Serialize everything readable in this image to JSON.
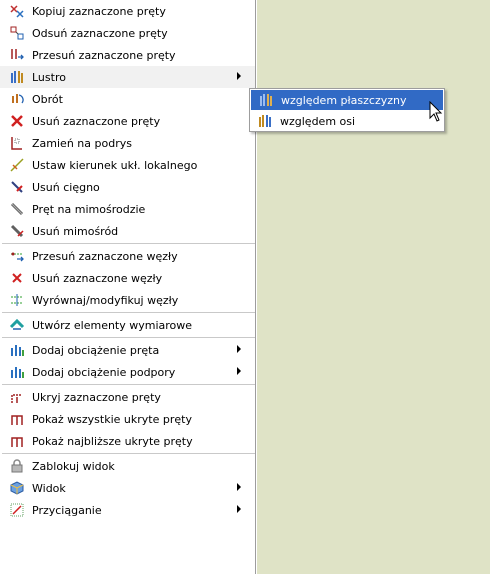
{
  "menu": {
    "items": [
      {
        "label": "Kopiuj zaznaczone pręty",
        "icon": "copy-bars-icon"
      },
      {
        "label": "Odsuń zaznaczone pręty",
        "icon": "offset-bars-icon"
      },
      {
        "label": "Przesuń zaznaczone pręty",
        "icon": "move-bars-icon"
      },
      {
        "label": "Lustro",
        "icon": "mirror-icon",
        "has_submenu": true
      },
      {
        "label": "Obrót",
        "icon": "rotate-icon"
      },
      {
        "label": "Usuń zaznaczone pręty",
        "icon": "delete-bars-icon"
      },
      {
        "label": "Zamień na podrys",
        "icon": "convert-underlay-icon"
      },
      {
        "label": "Ustaw kierunek ukł. lokalnego",
        "icon": "local-axis-icon"
      },
      {
        "label": "Usuń cięgno",
        "icon": "delete-cable-icon"
      },
      {
        "label": "Pręt na mimośrodzie",
        "icon": "eccentric-bar-icon"
      },
      {
        "label": "Usuń mimośród",
        "icon": "delete-eccentric-icon"
      },
      {
        "label": "Przesuń zaznaczone węzły",
        "icon": "move-nodes-icon"
      },
      {
        "label": "Usuń zaznaczone węzły",
        "icon": "delete-nodes-icon"
      },
      {
        "label": "Wyrównaj/modyfikuj węzły",
        "icon": "align-nodes-icon"
      },
      {
        "label": "Utwórz elementy wymiarowe",
        "icon": "dimension-elements-icon"
      },
      {
        "label": "Dodaj obciążenie pręta",
        "icon": "bar-load-icon",
        "has_submenu": true
      },
      {
        "label": "Dodaj obciążenie podpory",
        "icon": "support-load-icon",
        "has_submenu": true
      },
      {
        "label": "Ukryj zaznaczone pręty",
        "icon": "hide-bars-icon"
      },
      {
        "label": "Pokaż wszystkie ukryte pręty",
        "icon": "show-all-bars-icon"
      },
      {
        "label": "Pokaż najbliższe ukryte pręty",
        "icon": "show-nearest-bars-icon"
      },
      {
        "label": "Zablokuj widok",
        "icon": "lock-icon"
      },
      {
        "label": "Widok",
        "icon": "view-icon",
        "has_submenu": true
      },
      {
        "label": "Przyciąganie",
        "icon": "snap-icon",
        "has_submenu": true
      }
    ]
  },
  "submenu": {
    "items": [
      {
        "label": "względem płaszczyzny",
        "icon": "mirror-plane-icon",
        "active": true
      },
      {
        "label": "względem osi",
        "icon": "mirror-axis-icon",
        "active": false
      }
    ]
  },
  "colors": {
    "canvas_bg": "#dfe3c6",
    "highlight": "#316ac5"
  }
}
